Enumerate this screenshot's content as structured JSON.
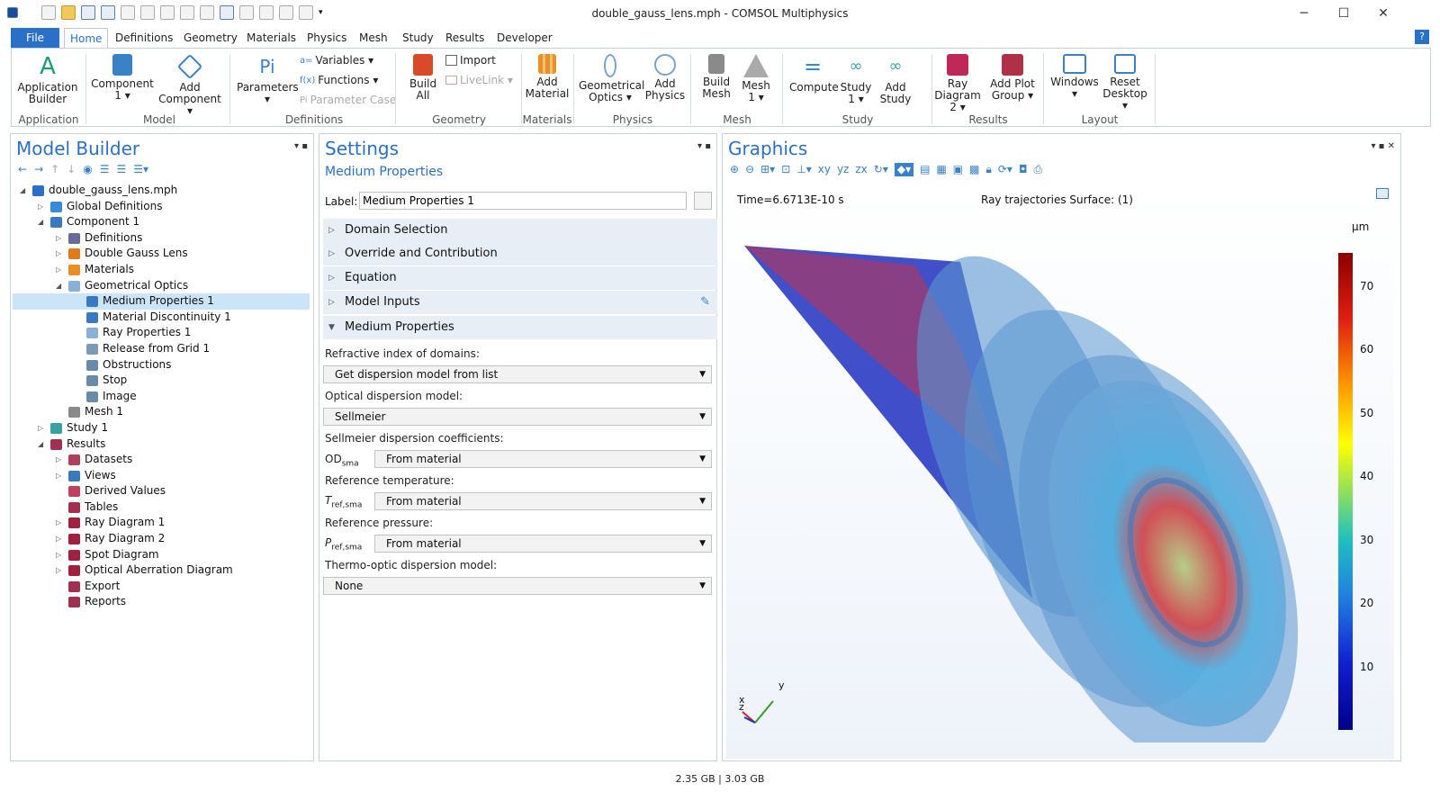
{
  "window": {
    "title": "double_gauss_lens.mph - COMSOL Multiphysics",
    "minimize": "─",
    "maximize": "☐",
    "close": "✕"
  },
  "menu": {
    "file": "File",
    "tabs": [
      "Home",
      "Definitions",
      "Geometry",
      "Materials",
      "Physics",
      "Mesh",
      "Study",
      "Results",
      "Developer"
    ],
    "help": "?"
  },
  "ribbon": {
    "app_builder": [
      "Application",
      "Builder"
    ],
    "component": [
      "Component",
      "1 ▾"
    ],
    "add_component": [
      "Add",
      "Component ▾"
    ],
    "parameters": [
      "Parameters",
      "▾"
    ],
    "variables": "Variables ▾",
    "functions": "Functions ▾",
    "parameter_case": "Parameter Case",
    "build_all": [
      "Build",
      "All"
    ],
    "import": "Import",
    "livelink": "LiveLink ▾",
    "add_material": [
      "Add",
      "Material"
    ],
    "geometrical_optics": [
      "Geometrical",
      "Optics ▾"
    ],
    "add_physics": [
      "Add",
      "Physics"
    ],
    "build_mesh": [
      "Build",
      "Mesh"
    ],
    "mesh": [
      "Mesh",
      "1 ▾"
    ],
    "compute": "Compute",
    "study": [
      "Study",
      "1 ▾"
    ],
    "add_study": [
      "Add",
      "Study"
    ],
    "ray_diagram": [
      "Ray",
      "Diagram 2 ▾"
    ],
    "add_plot_group": [
      "Add Plot",
      "Group ▾"
    ],
    "windows": [
      "Windows",
      "▾"
    ],
    "reset_desktop": [
      "Reset",
      "Desktop ▾"
    ],
    "groups": [
      "Application",
      "Model",
      "Definitions",
      "Geometry",
      "Materials",
      "Physics",
      "Mesh",
      "Study",
      "Results",
      "Layout"
    ]
  },
  "model_builder": {
    "title": "Model Builder",
    "tree": [
      {
        "label": "double_gauss_lens.mph",
        "level": 0,
        "toggle": "◢",
        "color": "#2a70c8"
      },
      {
        "label": "Global Definitions",
        "level": 1,
        "toggle": "▷",
        "color": "#3a8ad8"
      },
      {
        "label": "Component 1",
        "level": 1,
        "toggle": "◢",
        "color": "#3a78c0"
      },
      {
        "label": "Definitions",
        "level": 2,
        "toggle": "▷",
        "color": "#6a6a9a"
      },
      {
        "label": "Double Gauss Lens",
        "level": 2,
        "toggle": "▷",
        "color": "#e07b1a"
      },
      {
        "label": "Materials",
        "level": 2,
        "toggle": "▷",
        "color": "#e88f2a"
      },
      {
        "label": "Geometrical Optics",
        "level": 2,
        "toggle": "◢",
        "color": "#8ab0d8"
      },
      {
        "label": "Medium Properties 1",
        "level": 3,
        "toggle": "",
        "color": "#3a78c0",
        "selected": true
      },
      {
        "label": "Material Discontinuity 1",
        "level": 3,
        "toggle": "",
        "color": "#3a78c0"
      },
      {
        "label": "Ray Properties 1",
        "level": 3,
        "toggle": "",
        "color": "#8ab0d8"
      },
      {
        "label": "Release from Grid 1",
        "level": 3,
        "toggle": "",
        "color": "#7a9ab8"
      },
      {
        "label": "Obstructions",
        "level": 3,
        "toggle": "",
        "color": "#6a8aaa"
      },
      {
        "label": "Stop",
        "level": 3,
        "toggle": "",
        "color": "#6a8aaa"
      },
      {
        "label": "Image",
        "level": 3,
        "toggle": "",
        "color": "#6a8aaa"
      },
      {
        "label": "Mesh 1",
        "level": 2,
        "toggle": "",
        "color": "#8a8a8a"
      },
      {
        "label": "Study 1",
        "level": 1,
        "toggle": "▷",
        "color": "#3aa0a0"
      },
      {
        "label": "Results",
        "level": 1,
        "toggle": "◢",
        "color": "#a03050"
      },
      {
        "label": "Datasets",
        "level": 2,
        "toggle": "▷",
        "color": "#b04060"
      },
      {
        "label": "Views",
        "level": 2,
        "toggle": "▷",
        "color": "#3a78c0"
      },
      {
        "label": "Derived Values",
        "level": 2,
        "toggle": "",
        "color": "#c04060"
      },
      {
        "label": "Tables",
        "level": 2,
        "toggle": "",
        "color": "#a03050"
      },
      {
        "label": "Ray Diagram 1",
        "level": 2,
        "toggle": "▷",
        "color": "#a02040"
      },
      {
        "label": "Ray Diagram 2",
        "level": 2,
        "toggle": "▷",
        "color": "#a02040"
      },
      {
        "label": "Spot Diagram",
        "level": 2,
        "toggle": "▷",
        "color": "#a02040"
      },
      {
        "label": "Optical Aberration Diagram",
        "level": 2,
        "toggle": "▷",
        "color": "#a02040"
      },
      {
        "label": "Export",
        "level": 2,
        "toggle": "",
        "color": "#a03050"
      },
      {
        "label": "Reports",
        "level": 2,
        "toggle": "",
        "color": "#a03050"
      }
    ]
  },
  "settings": {
    "title": "Settings",
    "subtitle": "Medium Properties",
    "label_caption": "Label:",
    "label_value": "Medium Properties 1",
    "sections": [
      "Domain Selection",
      "Override and Contribution",
      "Equation",
      "Model Inputs",
      "Medium Properties"
    ],
    "refractive_label": "Refractive index of domains:",
    "refractive_value": "Get dispersion model from list",
    "optical_dispersion_label": "Optical dispersion model:",
    "optical_dispersion_value": "Sellmeier",
    "sellmeier_label": "Sellmeier dispersion coefficients:",
    "od_symbol": "OD",
    "od_sub": "sma",
    "od_value": "From material",
    "ref_temp_label": "Reference temperature:",
    "t_symbol": "T",
    "t_sub": "ref,sma",
    "t_value": "From material",
    "ref_pressure_label": "Reference pressure:",
    "p_symbol": "P",
    "p_sub": "ref,sma",
    "p_value": "From material",
    "thermo_label": "Thermo-optic dispersion model:",
    "thermo_value": "None"
  },
  "graphics": {
    "title": "Graphics",
    "time": "Time=6.6713E-10 s",
    "plot_title": "Ray trajectories  Surface:  (1)",
    "unit": "µm",
    "colorbar_ticks": [
      "70",
      "60",
      "50",
      "40",
      "30",
      "20",
      "10"
    ],
    "axis_x": "x",
    "axis_y": "y",
    "axis_z": "z"
  },
  "status": {
    "memory": "2.35 GB | 3.03 GB"
  }
}
